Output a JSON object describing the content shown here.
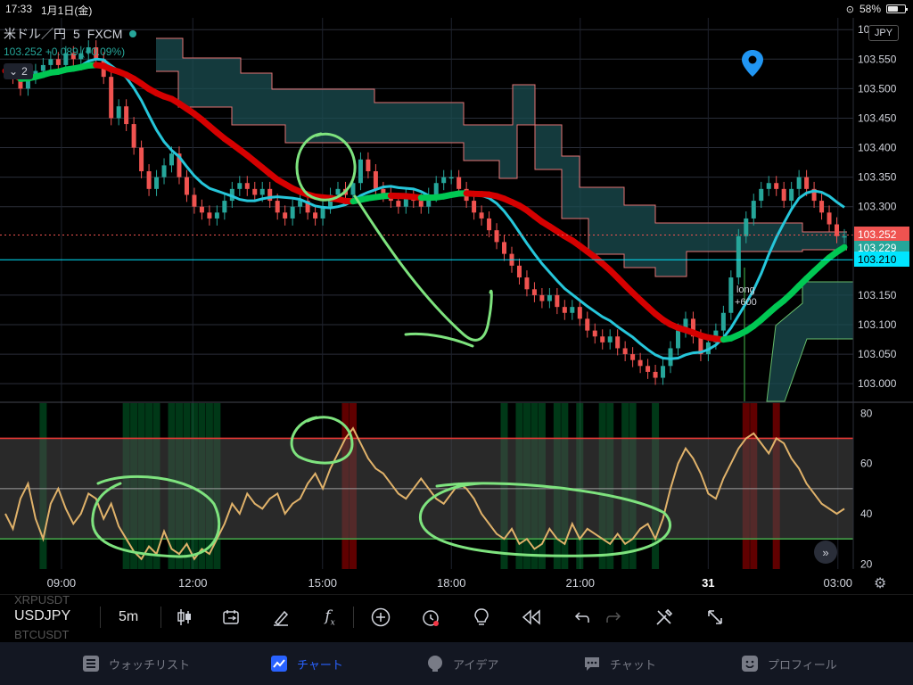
{
  "status_bar": {
    "time": "17:33",
    "date": "1月1日(金)",
    "battery": "58%"
  },
  "legend": {
    "symbol_title": "米ドル／円",
    "interval": "5",
    "source": "FXCM",
    "quote": "103.252 +0.089 (+0.09%)",
    "collapse_count": "2"
  },
  "currency_badge": "JPY",
  "annotations": {
    "long_label": "long",
    "long_value": "+600"
  },
  "chart_data": [
    {
      "type": "candlestick",
      "title": "米ドル／円 5 FXCM",
      "price_axis": {
        "ticks": [
          "103.600",
          "103.550",
          "103.500",
          "103.450",
          "103.400",
          "103.350",
          "103.300",
          "103.150",
          "103.100",
          "103.050",
          "103.000"
        ],
        "ylim": [
          102.97,
          103.62
        ]
      },
      "price_labels": [
        {
          "value": "103.252",
          "color": "#ef5350"
        },
        {
          "value": "103.229",
          "color": "#26a69a"
        },
        {
          "value": "103.210",
          "color": "#00e5ff"
        }
      ],
      "time_axis": [
        "09:00",
        "12:00",
        "15:00",
        "18:00",
        "21:00",
        "31",
        "03:00"
      ],
      "close": [
        103.53,
        103.52,
        103.5,
        103.52,
        103.53,
        103.54,
        103.55,
        103.54,
        103.56,
        103.55,
        103.56,
        103.57,
        103.55,
        103.52,
        103.45,
        103.47,
        103.44,
        103.4,
        103.36,
        103.33,
        103.35,
        103.37,
        103.39,
        103.35,
        103.32,
        103.3,
        103.29,
        103.28,
        103.29,
        103.31,
        103.33,
        103.34,
        103.33,
        103.32,
        103.33,
        103.31,
        103.29,
        103.28,
        103.3,
        103.31,
        103.29,
        103.28,
        103.3,
        103.32,
        103.33,
        103.32,
        103.34,
        103.38,
        103.36,
        103.33,
        103.32,
        103.31,
        103.3,
        103.32,
        103.31,
        103.3,
        103.32,
        103.34,
        103.35,
        103.35,
        103.33,
        103.31,
        103.29,
        103.28,
        103.26,
        103.24,
        103.22,
        103.2,
        103.18,
        103.16,
        103.15,
        103.14,
        103.15,
        103.13,
        103.12,
        103.13,
        103.11,
        103.09,
        103.08,
        103.07,
        103.08,
        103.06,
        103.05,
        103.04,
        103.03,
        103.02,
        103.01,
        103.03,
        103.06,
        103.09,
        103.11,
        103.08,
        103.05,
        103.07,
        103.09,
        103.12,
        103.18,
        103.25,
        103.28,
        103.31,
        103.33,
        103.34,
        103.33,
        103.31,
        103.33,
        103.35,
        103.33,
        103.31,
        103.29,
        103.27,
        103.25,
        103.25
      ],
      "indicators": {
        "moving_average_colors": [
          "#00c853",
          "#d50000"
        ],
        "signal_line_color": "#26c6da"
      }
    },
    {
      "type": "line",
      "title": "",
      "ylim": [
        18,
        84
      ],
      "y_ticks": [
        "80",
        "60",
        "40",
        "20"
      ],
      "levels": [
        {
          "value": 70,
          "color": "#e53935"
        },
        {
          "value": 50,
          "color": "#9e9e9e"
        },
        {
          "value": 30,
          "color": "#43a047"
        }
      ],
      "values": [
        40,
        34,
        46,
        52,
        38,
        30,
        44,
        50,
        42,
        36,
        40,
        48,
        46,
        38,
        44,
        35,
        30,
        25,
        22,
        27,
        24,
        33,
        26,
        24,
        28,
        22,
        26,
        24,
        30,
        36,
        44,
        40,
        48,
        44,
        42,
        46,
        48,
        40,
        44,
        46,
        52,
        56,
        50,
        58,
        64,
        70,
        74,
        68,
        62,
        58,
        56,
        52,
        48,
        46,
        50,
        54,
        50,
        46,
        44,
        48,
        52,
        50,
        46,
        40,
        36,
        32,
        30,
        34,
        28,
        30,
        26,
        28,
        34,
        30,
        28,
        36,
        30,
        34,
        32,
        30,
        28,
        32,
        28,
        30,
        34,
        36,
        30,
        38,
        50,
        60,
        66,
        62,
        56,
        48,
        46,
        54,
        60,
        66,
        70,
        72,
        68,
        64,
        70,
        68,
        62,
        58,
        52,
        48,
        44,
        42,
        40,
        42
      ],
      "signal_bands": [
        {
          "color": "#00c853",
          "kind": "oversold"
        },
        {
          "color": "#d50000",
          "kind": "overbought"
        }
      ]
    }
  ],
  "toolbar": {
    "symbol_prev": "XRPUSDT",
    "symbol": "USDJPY",
    "symbol_next": "BTCUSDT",
    "interval": "5m",
    "icons": [
      "candles-icon",
      "compare-icon",
      "draw-icon",
      "indicator-icon",
      "add-icon",
      "alert-icon",
      "idea-icon",
      "replay-icon",
      "undo-icon",
      "redo-icon",
      "tools-icon",
      "fullscreen-icon"
    ]
  },
  "bottom_nav": {
    "items": [
      {
        "label": "ウォッチリスト",
        "icon": "list-icon",
        "active": false
      },
      {
        "label": "チャート",
        "icon": "chart-icon",
        "active": true
      },
      {
        "label": "アイデア",
        "icon": "bulb-icon",
        "active": false
      },
      {
        "label": "チャット",
        "icon": "chat-icon",
        "active": false
      },
      {
        "label": "プロフィール",
        "icon": "smile-icon",
        "active": false
      }
    ]
  }
}
